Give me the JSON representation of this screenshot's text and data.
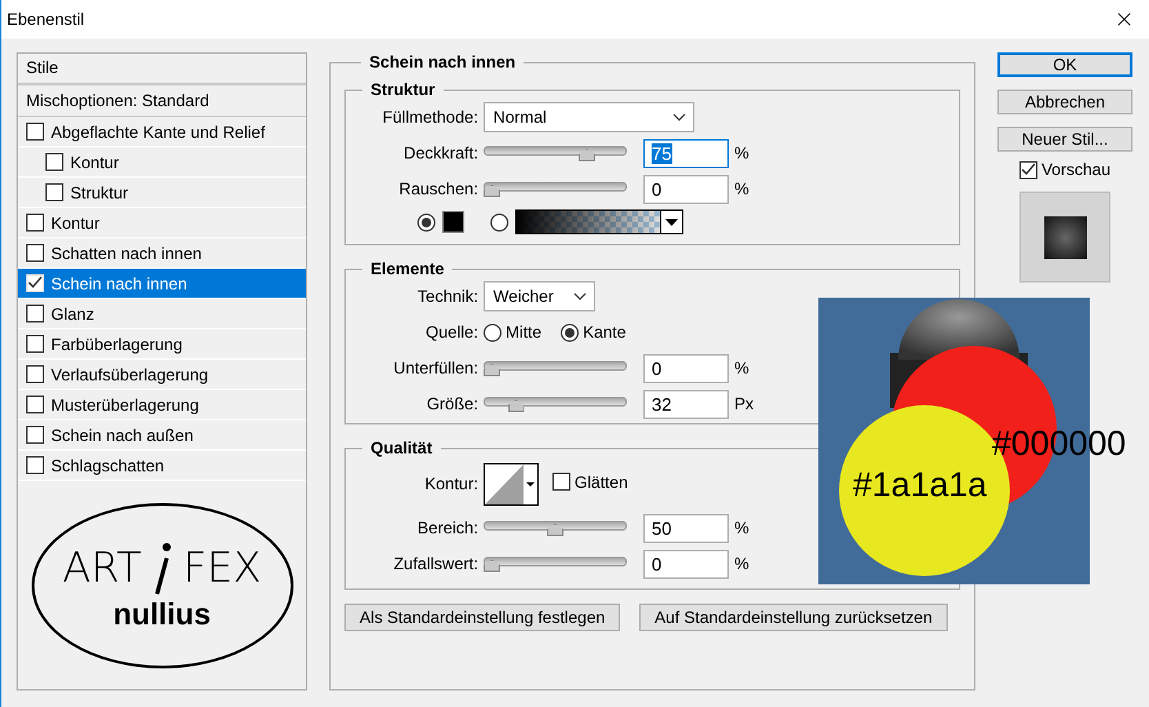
{
  "window": {
    "title": "Ebenenstil"
  },
  "styles_panel": {
    "header": "Stile",
    "blend_options": "Mischoptionen: Standard",
    "items": [
      {
        "label": "Abgeflachte Kante und Relief",
        "checked": false,
        "selected": false,
        "children": [
          {
            "label": "Kontur",
            "checked": false,
            "selected": false
          },
          {
            "label": "Struktur",
            "checked": false,
            "selected": false
          }
        ]
      },
      {
        "label": "Kontur",
        "checked": false,
        "selected": false
      },
      {
        "label": "Schatten nach innen",
        "checked": false,
        "selected": false
      },
      {
        "label": "Schein nach innen",
        "checked": true,
        "selected": true
      },
      {
        "label": "Glanz",
        "checked": false,
        "selected": false
      },
      {
        "label": "Farbüberlagerung",
        "checked": false,
        "selected": false
      },
      {
        "label": "Verlaufsüberlagerung",
        "checked": false,
        "selected": false
      },
      {
        "label": "Musterüberlagerung",
        "checked": false,
        "selected": false
      },
      {
        "label": "Schein nach außen",
        "checked": false,
        "selected": false
      },
      {
        "label": "Schlagschatten",
        "checked": false,
        "selected": false
      }
    ]
  },
  "logo": {
    "left": "ART",
    "right": "FEX",
    "subtitle": "nullius"
  },
  "panel": {
    "title": "Schein nach innen",
    "struktur": {
      "title": "Struktur",
      "blend_mode": {
        "label": "Füllmethode:",
        "value": "Normal"
      },
      "sliders": [
        {
          "label": "Deckkraft:",
          "level": 0.75,
          "value": "75",
          "unit": "%",
          "focused": true
        },
        {
          "label": "Rauschen:",
          "level": 0,
          "value": "0",
          "unit": "%",
          "focused": false
        }
      ],
      "fill_options": [
        {
          "kind": "solid",
          "selected": true
        },
        {
          "kind": "gradient",
          "selected": false
        }
      ]
    },
    "elemente": {
      "title": "Elemente",
      "technique": {
        "label": "Technik:",
        "value": "Weicher"
      },
      "source": {
        "label": "Quelle:",
        "options": [
          {
            "label": "Mitte",
            "selected": false
          },
          {
            "label": "Kante",
            "selected": true
          }
        ]
      },
      "sliders": [
        {
          "label": "Unterfüllen:",
          "level": 0,
          "value": "0",
          "unit": "%",
          "focused": false
        },
        {
          "label": "Größe:",
          "level": 0.19,
          "value": "32",
          "unit": "Px",
          "focused": false
        }
      ]
    },
    "qualitaet": {
      "title": "Qualität",
      "contour": {
        "label": "Kontur:"
      },
      "smooth": {
        "label": "Glätten",
        "checked": false
      },
      "sliders": [
        {
          "label": "Bereich:",
          "level": 0.5,
          "value": "50",
          "unit": "%",
          "focused": false
        },
        {
          "label": "Zufallswert:",
          "level": 0,
          "value": "0",
          "unit": "%",
          "focused": false
        }
      ]
    },
    "buttons": [
      "Als Standardeinstellung festlegen",
      "Auf Standardeinstellung zurücksetzen"
    ]
  },
  "actions": [
    {
      "label": "OK",
      "default": true
    },
    {
      "label": "Abbrechen",
      "default": false
    },
    {
      "label": "Neuer Stil...",
      "default": false
    }
  ],
  "preview": {
    "label": "Vorschau",
    "checked": true
  },
  "overlay": {
    "labels": [
      "#000000",
      "#1a1a1a"
    ]
  }
}
